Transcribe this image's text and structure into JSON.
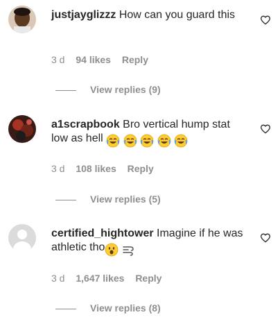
{
  "comments": [
    {
      "username": "justjayglizzz",
      "text": "How can you guard this",
      "time": "3 d",
      "likes": "94 likes",
      "reply": "Reply",
      "view_replies": "View replies (9)"
    },
    {
      "username": "a1scrapbook",
      "text": "Bro vertical hump stat low as hell",
      "emojis": "😂😂😂😂😂",
      "time": "3 d",
      "likes": "108 likes",
      "reply": "Reply",
      "view_replies": "View replies (5)"
    },
    {
      "username": "certified_hightower",
      "text": "Imagine if he was athletic tho",
      "emojis": "😮💨",
      "time": "3 d",
      "likes": "1,647 likes",
      "reply": "Reply",
      "view_replies": "View replies (8)"
    }
  ],
  "icons": {
    "like": "heart-outline-icon",
    "emoji_laugh": "face-with-tears-of-joy-icon",
    "emoji_surprised": "face-with-open-mouth-icon",
    "emoji_exhale": "dashing-away-icon"
  }
}
